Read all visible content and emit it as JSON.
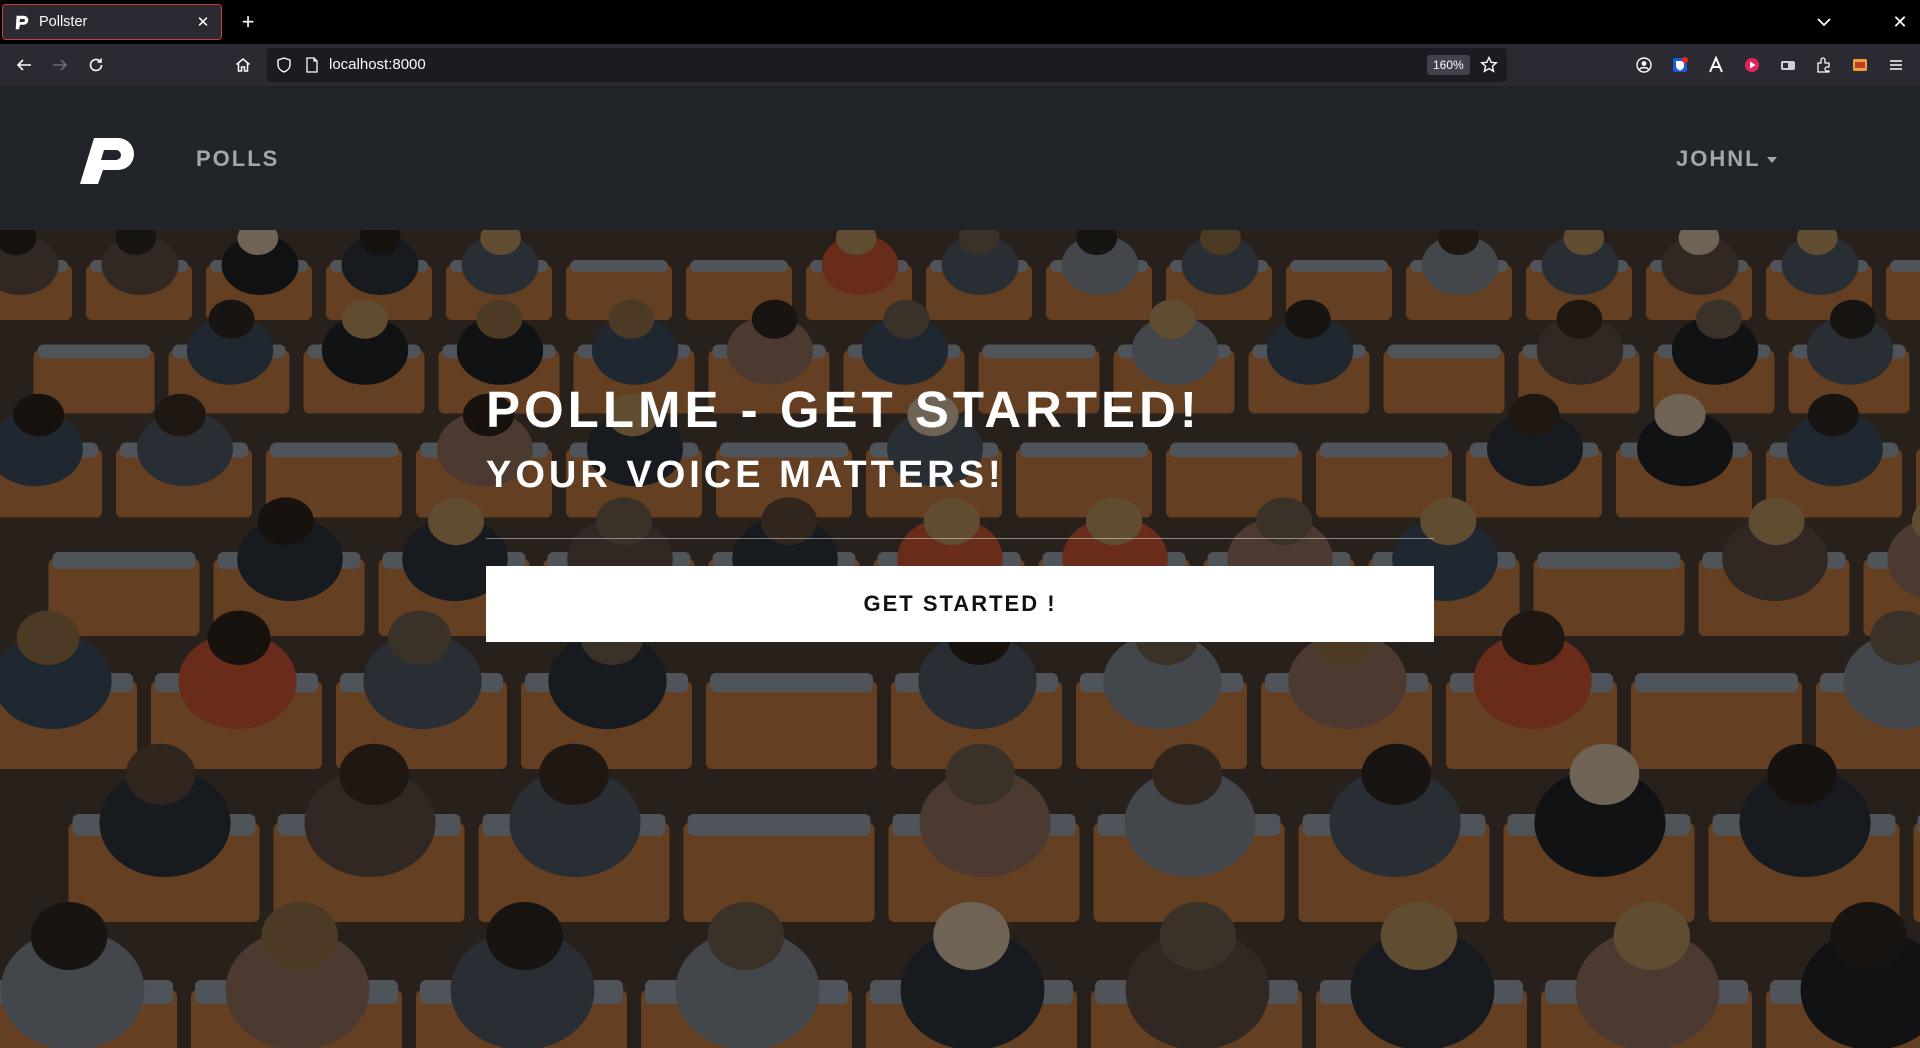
{
  "browser": {
    "tab_title": "Pollster",
    "url": "localhost:8000",
    "zoom": "160%"
  },
  "site": {
    "nav_polls": "POLLS",
    "user_menu": "JOHNL"
  },
  "hero": {
    "title": "POLLME - GET STARTED!",
    "subtitle": "YOUR VOICE MATTERS!",
    "cta_label": "GET STARTED !"
  },
  "colors": {
    "header_bg": "#212529",
    "nav_text": "#a4a6a9",
    "tab_active_border": "#d23a3f"
  },
  "icons": [
    "back-icon",
    "forward-icon",
    "reload-icon",
    "home-icon",
    "shield-icon",
    "page-icon",
    "star-icon",
    "account-icon",
    "bitwarden-icon",
    "font-icon",
    "record-icon",
    "tab-icon",
    "extensions-icon",
    "wallet-icon",
    "menu-icon"
  ]
}
